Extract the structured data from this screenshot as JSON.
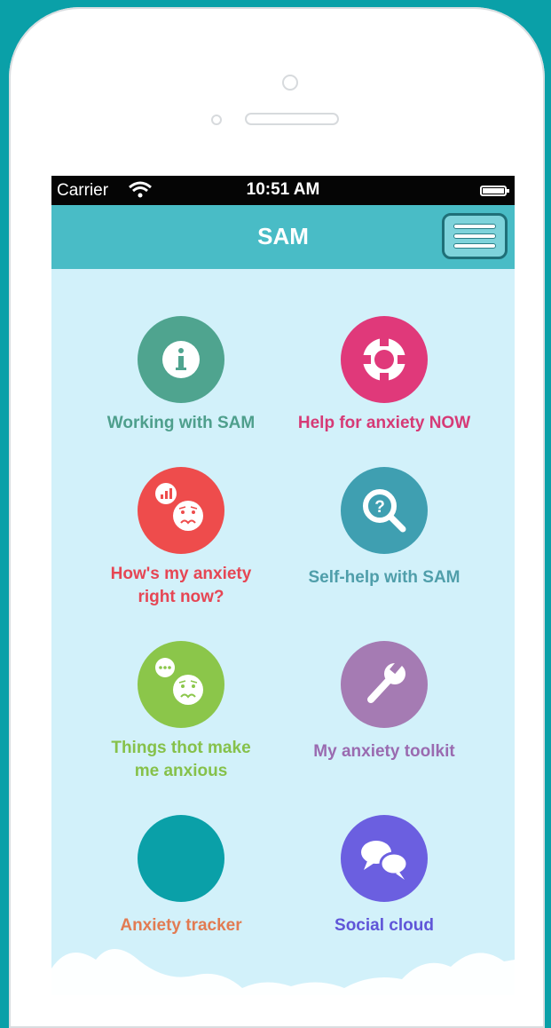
{
  "statusbar": {
    "carrier": "Carrier",
    "time": "10:51 AM"
  },
  "navbar": {
    "title": "SAM"
  },
  "tiles": [
    {
      "label": "Working with SAM",
      "color": "#4fa48f",
      "text_color": "#4e9f8c",
      "icon": "info-icon"
    },
    {
      "label": "Help for anxiety NOW",
      "color": "#e0397a",
      "text_color": "#d63a76",
      "icon": "lifebuoy-icon"
    },
    {
      "label_line1": "How's my anxiety",
      "label_line2": "right now?",
      "color": "#ee4c4c",
      "text_color": "#e64654",
      "icon": "worried-face-icon"
    },
    {
      "label": "Self-help with SAM",
      "color": "#3f9fb1",
      "text_color": "#4f9eaa",
      "icon": "search-help-icon"
    },
    {
      "label_line1": "Things thot make",
      "label_line2": "me anxious",
      "color": "#8bc64a",
      "text_color": "#86c14a",
      "icon": "anxious-thoughts-icon"
    },
    {
      "label": "My anxiety toolkit",
      "color": "#a57bb3",
      "text_color": "#9a6bb0",
      "icon": "wrench-icon"
    },
    {
      "label": "Anxiety tracker",
      "color": "#0aa0a8",
      "text_color": "#e27b52",
      "icon": "tracker-circle"
    },
    {
      "label": "Social cloud",
      "color": "#6b5fe0",
      "text_color": "#5f55d8",
      "icon": "speech-bubbles-icon"
    }
  ]
}
